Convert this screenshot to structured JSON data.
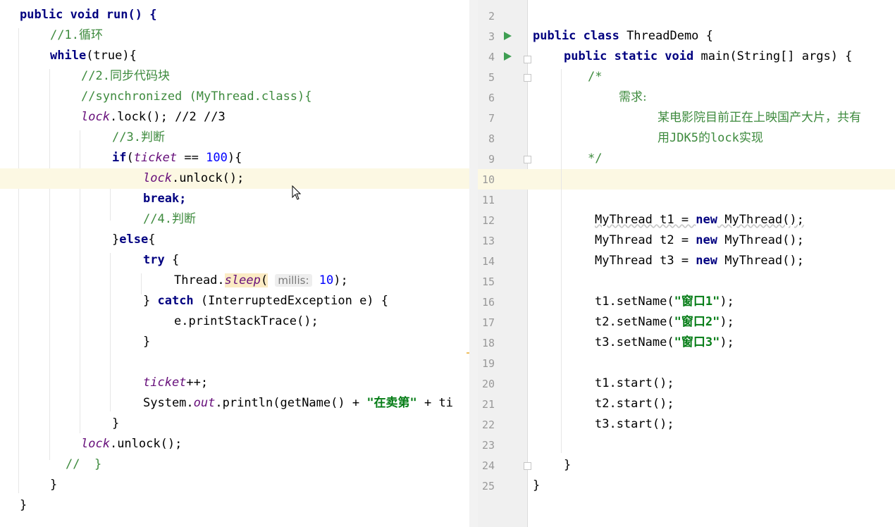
{
  "left_code": {
    "l0": "public void run() {",
    "l1": "//1.循环",
    "l2_kw": "while",
    "l2_rest": "(true){",
    "l3": "//2.同步代码块",
    "l4": "//synchronized (MyThread.class){",
    "l5_fld": "lock",
    "l5_rest": ".lock(); //2 //3",
    "l6": "//3.判断",
    "l7_kw": "if",
    "l7_fld": "ticket",
    "l7_mid": " == ",
    "l7_num": "100",
    "l7_end": "){",
    "l8_fld": "lock",
    "l8_rest": ".unlock();",
    "l9": "break;",
    "l10": "//4.判断",
    "l11_a": "}",
    "l11_kw": "else",
    "l11_b": "{",
    "l12_kw": "try",
    "l12_b": " {",
    "l13_a": "Thread.",
    "l13_m": "sleep",
    "l13_b": "(",
    "l13_hint": "millis:",
    "l13_num": "10",
    "l13_c": ");",
    "l14_a": "} ",
    "l14_kw": "catch",
    "l14_b": " (InterruptedException e) {",
    "l15": "e.printStackTrace();",
    "l16": "}",
    "l18_fld": "ticket",
    "l18_rest": "++;",
    "l19_a": "System.",
    "l19_fld": "out",
    "l19_b": ".println(getName() + ",
    "l19_str": "\"在卖第\"",
    "l19_c": " + ti",
    "l20": "}",
    "l21_fld": "lock",
    "l21_rest": ".unlock();",
    "l22": "//  }",
    "l23": "}",
    "l24": "}"
  },
  "right_code": {
    "line_numbers": [
      "2",
      "3",
      "4",
      "5",
      "6",
      "7",
      "8",
      "9",
      "10",
      "11",
      "12",
      "13",
      "14",
      "15",
      "16",
      "17",
      "18",
      "19",
      "20",
      "21",
      "22",
      "23",
      "24",
      "25"
    ],
    "r3_kw": "public class",
    "r3_rest": " ThreadDemo {",
    "r4_kw": "public static void",
    "r4_rest": " main(String[] args) {",
    "r5": "/*",
    "r6": "需求:",
    "r7": "某电影院目前正在上映国产大片，共有",
    "r8": "用JDK5的lock实现",
    "r9": "*/",
    "r12_a": "MyThread t1 = ",
    "r12_kw": "new",
    "r12_b": " MyThread();",
    "r13_a": "MyThread t2 = ",
    "r13_kw": "new",
    "r13_b": " MyThread();",
    "r14_a": "MyThread t3 = ",
    "r14_kw": "new",
    "r14_b": " MyThread();",
    "r16_a": "t1.setName(",
    "r16_s": "\"窗口1\"",
    "r16_b": ");",
    "r17_a": "t2.setName(",
    "r17_s": "\"窗口2\"",
    "r17_b": ");",
    "r18_a": "t3.setName(",
    "r18_s": "\"窗口3\"",
    "r18_b": ");",
    "r20": "t1.start();",
    "r21": "t2.start();",
    "r22": "t3.start();",
    "r24": "}",
    "r25": "}"
  },
  "icons": {
    "run_gutter": "run-arrow-icon",
    "fold_gutter": "fold-marker-icon",
    "mouse": "mouse-cursor-icon"
  },
  "colors": {
    "keyword": "#000080",
    "comment_green": "#3d8a3d",
    "string": "#067d17",
    "number": "#0000ff",
    "field": "#660e7a",
    "current_line": "#fcf8e3",
    "run_icon": "#3e9e52"
  }
}
